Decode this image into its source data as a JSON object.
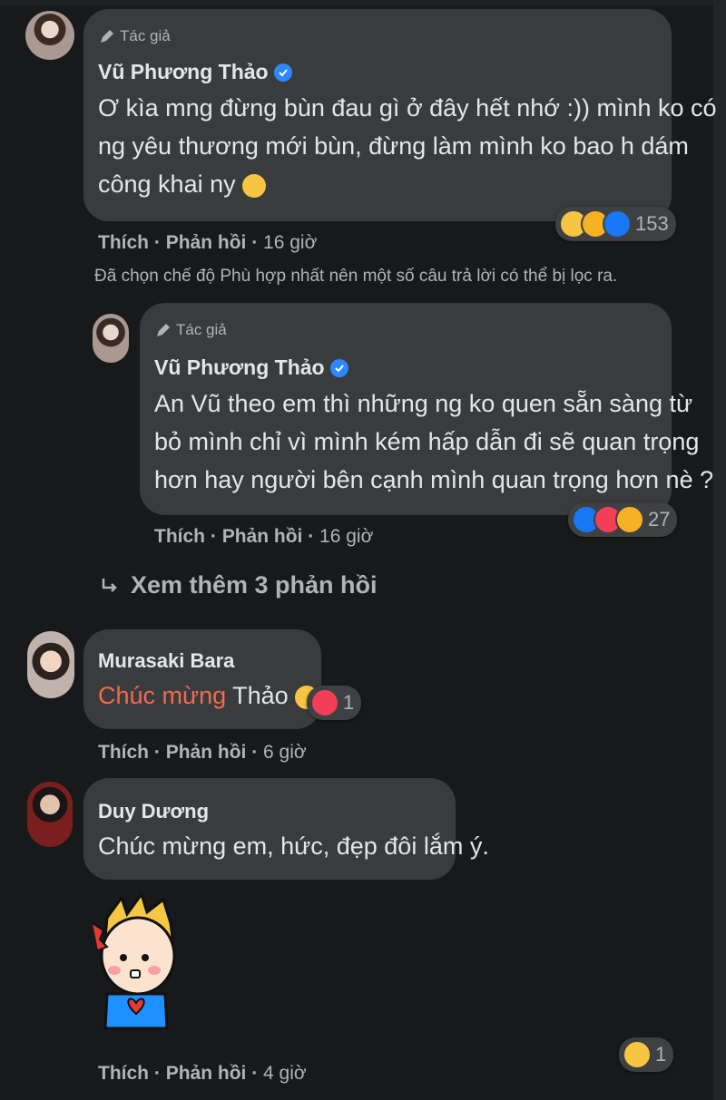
{
  "comments": [
    {
      "author_tag": "Tác giả",
      "name": "Vũ Phương Thảo",
      "lines": [
        "Ơ kìa mng đừng bùn đau gì ở đây hết nhớ :)) mình ko có",
        "ng yêu thương mới bùn, đừng làm mình ko bao h dám",
        "công khai ny"
      ],
      "like": "Thích",
      "reply": "Phản hồi",
      "time": "16 giờ",
      "reaction_count": "153"
    },
    {
      "author_tag": "Tác giả",
      "name": "Vũ Phương Thảo",
      "lines": [
        "An Vũ theo em thì những ng ko quen sẵn sàng từ",
        "bỏ mình chỉ vì mình kém hấp dẫn đi sẽ quan trọng",
        "hơn hay người bên cạnh mình quan trọng hơn nè ?"
      ],
      "like": "Thích",
      "reply": "Phản hồi",
      "time": "16 giờ",
      "reaction_count": "27"
    },
    {
      "name": "Murasaki Bara",
      "highlight": "Chúc mừng",
      "text_after": " Thảo",
      "like": "Thích",
      "reply": "Phản hồi",
      "time": "6 giờ",
      "reaction_count": "1"
    },
    {
      "name": "Duy Dương",
      "text": "Chúc mừng em, hức, đẹp đôi lắm ý.",
      "like": "Thích",
      "reply": "Phản hồi",
      "time": "4 giờ",
      "reaction_count": "1"
    }
  ],
  "filter_note": "Đã chọn chế độ Phù hợp nhất nên một số câu trả lời có thể bị lọc ra.",
  "see_more": "Xem thêm 3 phản hồi",
  "separator": "·",
  "colors": {
    "background": "#18191a",
    "bubble": "#3a3b3c",
    "accent": "#2d88ff",
    "highlight": "#f26a4f"
  }
}
